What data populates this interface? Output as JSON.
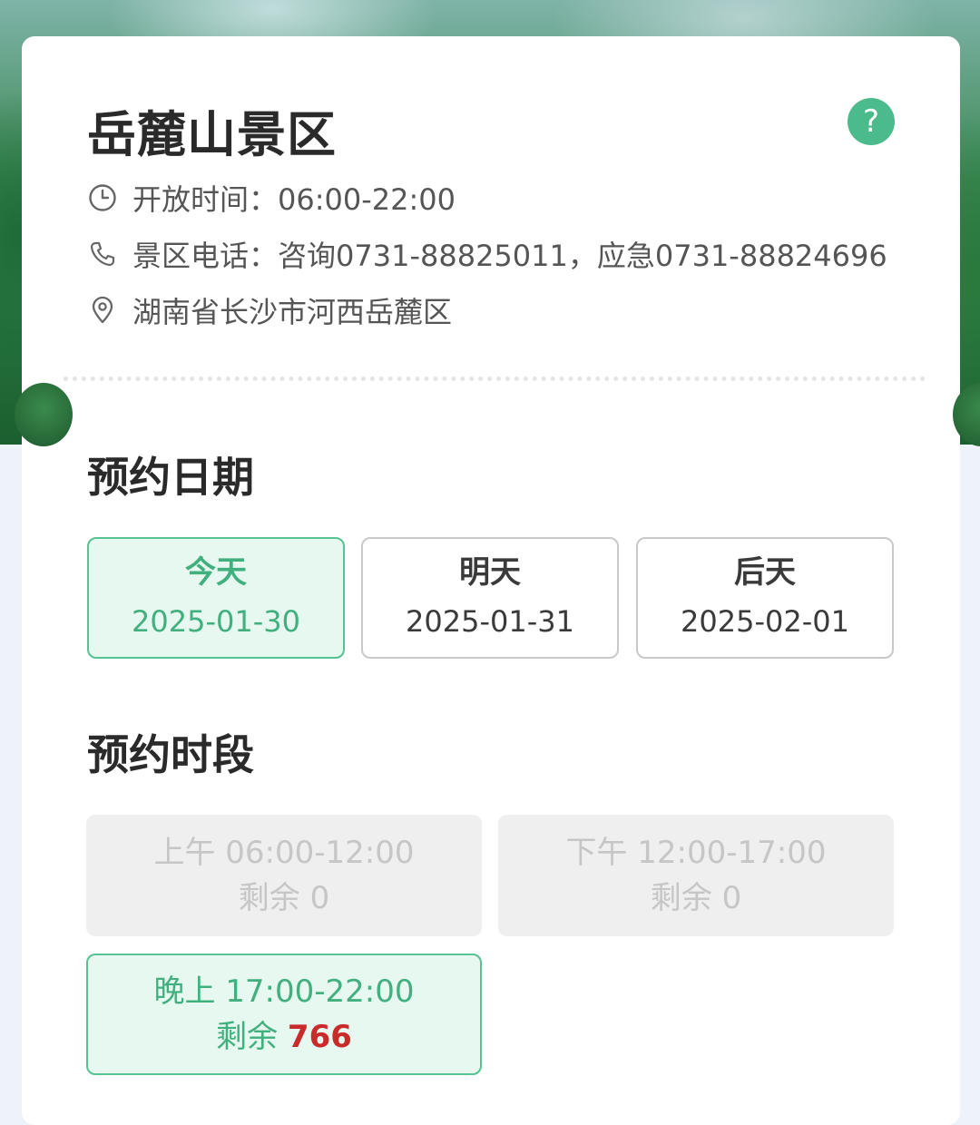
{
  "scenic": {
    "name": "岳麓山景区",
    "help_glyph": "?",
    "open_hours": "开放时间：06:00-22:00",
    "phone": "景区电话：咨询0731-88825011，应急0731-88824696",
    "address": "湖南省长沙市河西岳麓区"
  },
  "icons": {
    "open_hours": "clock-icon",
    "phone": "phone-icon",
    "address": "location-pin-icon",
    "help": "help-icon"
  },
  "booking_date": {
    "title": "预约日期",
    "options": [
      {
        "day": "今天",
        "date": "2025-01-30",
        "selected": true
      },
      {
        "day": "明天",
        "date": "2025-01-31",
        "selected": false
      },
      {
        "day": "后天",
        "date": "2025-02-01",
        "selected": false
      }
    ]
  },
  "booking_slot": {
    "title": "预约时段",
    "remain_label": "剩余",
    "slots": [
      {
        "label": "上午 06:00-12:00",
        "remaining": "0",
        "available": false
      },
      {
        "label": "下午 12:00-17:00",
        "remaining": "0",
        "available": false
      },
      {
        "label": "晚上 17:00-22:00",
        "remaining": "766",
        "available": true
      }
    ]
  },
  "colors": {
    "accent": "#41b07e",
    "accent_bg": "#e6f8ef",
    "remaining_highlight": "#c92a2a",
    "disabled_bg": "#efefef"
  }
}
